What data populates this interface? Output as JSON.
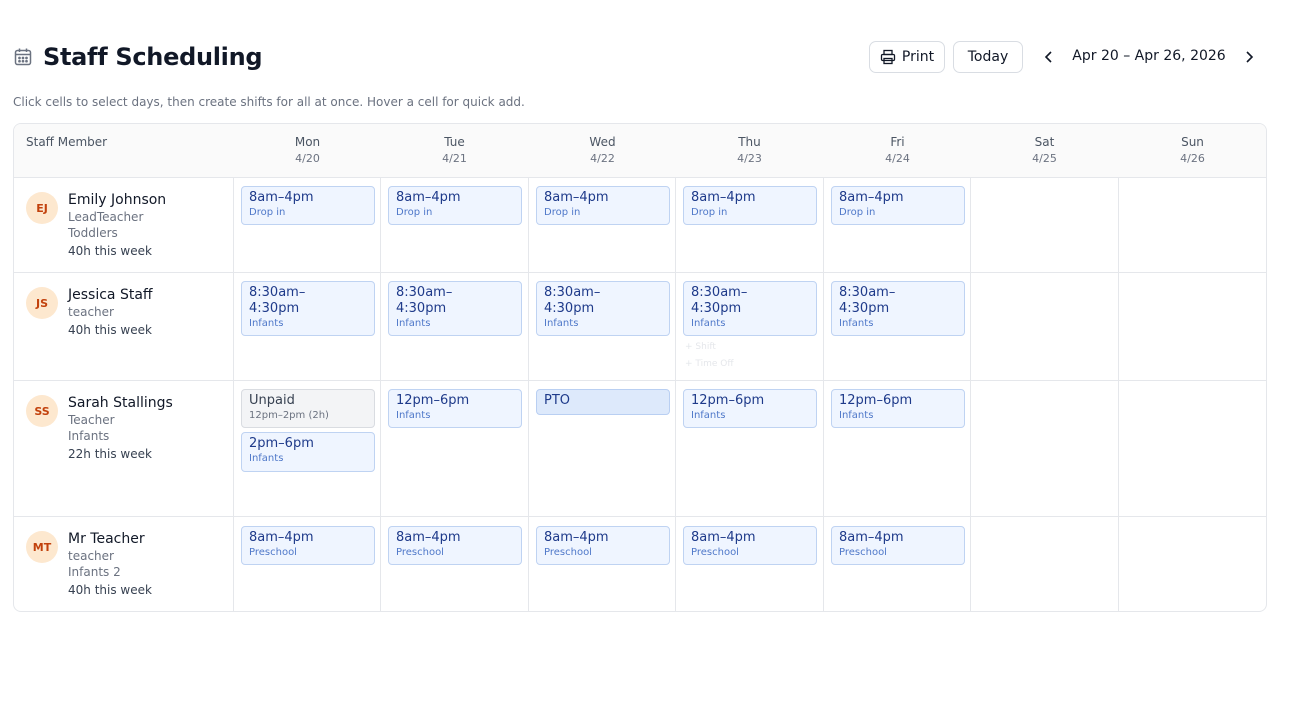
{
  "header": {
    "title": "Staff Scheduling",
    "print_label": "Print",
    "today_label": "Today",
    "range": "Apr 20 – Apr 26, 2026",
    "subtitle": "Click cells to select days, then create shifts for all at once. Hover a cell for quick add."
  },
  "icons": [
    "calendar-icon",
    "printer-icon",
    "chevron-left-icon",
    "chevron-right-icon"
  ],
  "colors": {
    "shift_bg": "#eff5ff",
    "shift_border": "#bfd3f2",
    "shift_text": "#1e3a8a",
    "avatar_bg": "#fde8cf",
    "avatar_text": "#c2410c"
  },
  "grid": {
    "staff_header": "Staff Member",
    "days": [
      {
        "name": "Mon",
        "date": "4/20"
      },
      {
        "name": "Tue",
        "date": "4/21"
      },
      {
        "name": "Wed",
        "date": "4/22"
      },
      {
        "name": "Thu",
        "date": "4/23"
      },
      {
        "name": "Fri",
        "date": "4/24"
      },
      {
        "name": "Sat",
        "date": "4/25"
      },
      {
        "name": "Sun",
        "date": "4/26"
      }
    ]
  },
  "staff": [
    {
      "initials": "EJ",
      "name": "Emily Johnson",
      "role": "LeadTeacher",
      "room": "Toddlers",
      "hours": "40h this week",
      "shifts": [
        [
          {
            "time": "8am–4pm",
            "room": "Drop in"
          }
        ],
        [
          {
            "time": "8am–4pm",
            "room": "Drop in"
          }
        ],
        [
          {
            "time": "8am–4pm",
            "room": "Drop in"
          }
        ],
        [
          {
            "time": "8am–4pm",
            "room": "Drop in"
          }
        ],
        [
          {
            "time": "8am–4pm",
            "room": "Drop in"
          }
        ]
      ]
    },
    {
      "initials": "JS",
      "name": "Jessica Staff",
      "role": "teacher",
      "room": "",
      "hours": "40h this week",
      "shifts": [
        [
          {
            "time_1": "8:30am–",
            "time_2": "4:30pm",
            "room": "Infants"
          }
        ],
        [
          {
            "time_1": "8:30am–",
            "time_2": "4:30pm",
            "room": "Infants"
          }
        ],
        [
          {
            "time_1": "8:30am–",
            "time_2": "4:30pm",
            "room": "Infants"
          }
        ],
        [
          {
            "time_1": "8:30am–",
            "time_2": "4:30pm",
            "room": "Infants"
          }
        ],
        [
          {
            "time_1": "8:30am–",
            "time_2": "4:30pm",
            "room": "Infants"
          }
        ]
      ],
      "quick_add": [
        "+ Shift",
        "+ Time Off"
      ]
    },
    {
      "initials": "SS",
      "name": "Sarah Stallings",
      "role": "Teacher",
      "room": "Infants",
      "hours": "22h this week",
      "shifts": [
        [
          {
            "time": "Unpaid",
            "room": "12pm–2pm (2h)",
            "kind": "unpaid"
          },
          {
            "time": "2pm–6pm",
            "room": "Infants"
          }
        ],
        [
          {
            "time": "12pm–6pm",
            "room": "Infants"
          }
        ],
        [
          {
            "time": "PTO",
            "kind": "pto"
          }
        ],
        [
          {
            "time": "12pm–6pm",
            "room": "Infants"
          }
        ],
        [
          {
            "time": "12pm–6pm",
            "room": "Infants"
          }
        ]
      ]
    },
    {
      "initials": "MT",
      "name": "Mr Teacher",
      "role": "teacher",
      "room": "Infants 2",
      "hours": "40h this week",
      "shifts": [
        [
          {
            "time": "8am–4pm",
            "room": "Preschool"
          }
        ],
        [
          {
            "time": "8am–4pm",
            "room": "Preschool"
          }
        ],
        [
          {
            "time": "8am–4pm",
            "room": "Preschool"
          }
        ],
        [
          {
            "time": "8am–4pm",
            "room": "Preschool"
          }
        ],
        [
          {
            "time": "8am–4pm",
            "room": "Preschool"
          }
        ]
      ]
    }
  ]
}
